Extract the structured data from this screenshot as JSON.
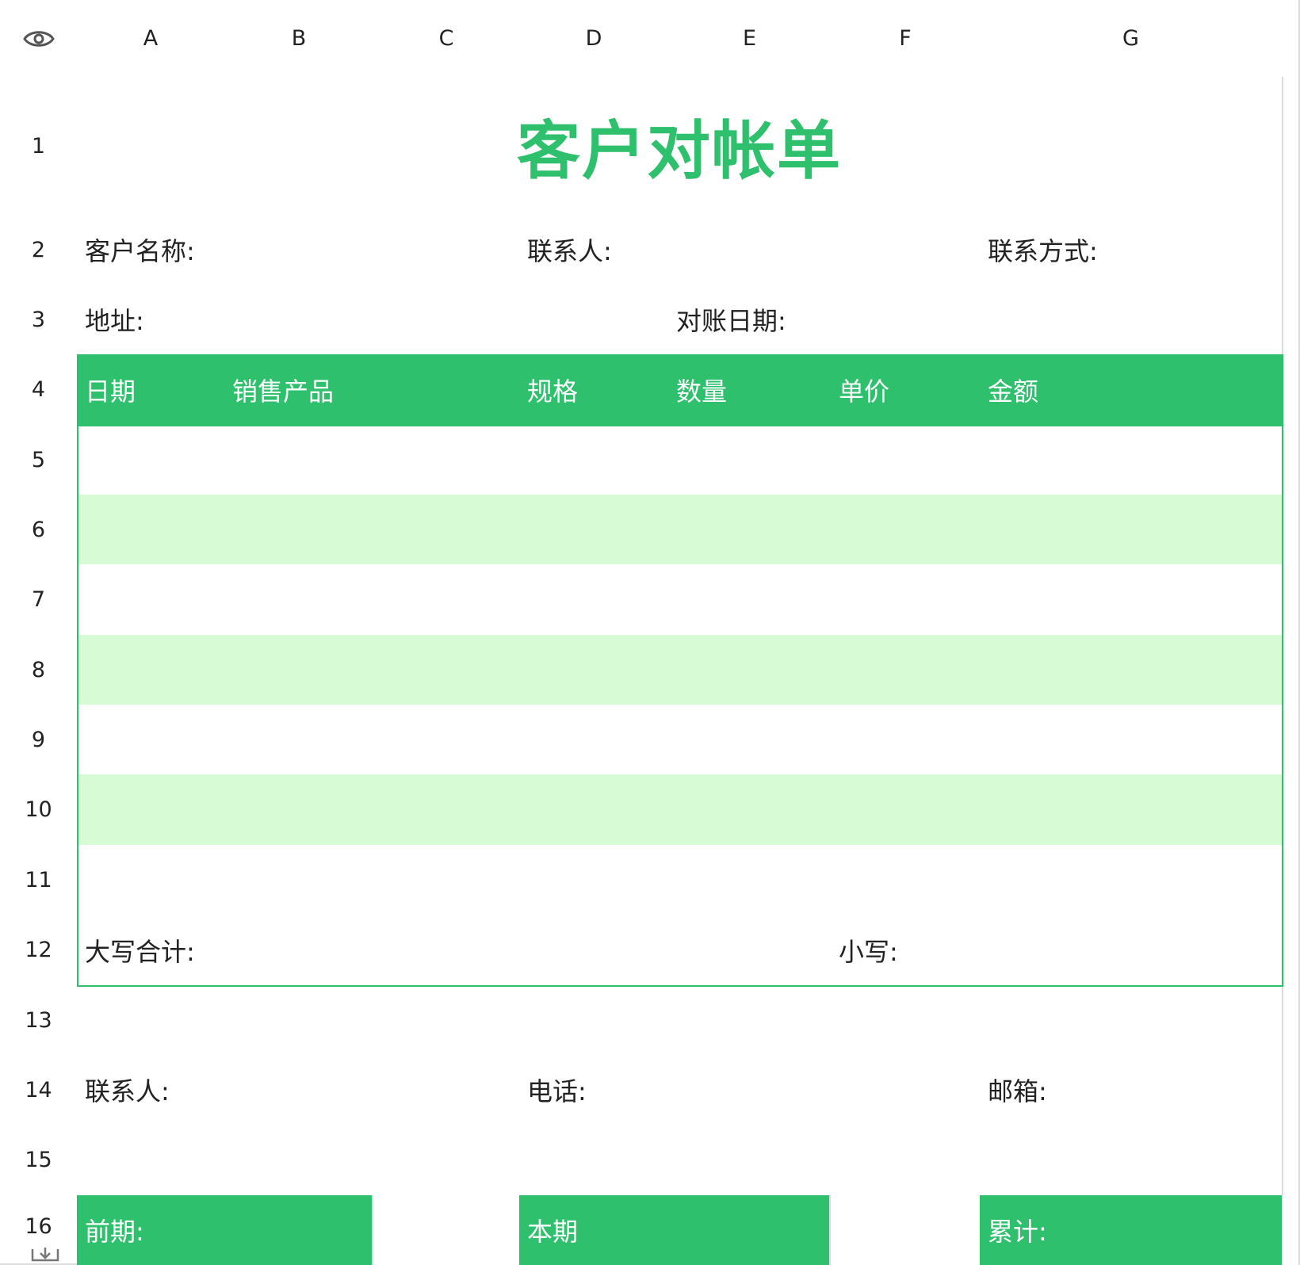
{
  "app": {
    "column_headers": [
      "A",
      "B",
      "C",
      "D",
      "E",
      "F",
      "G"
    ],
    "row_headers": [
      "1",
      "2",
      "3",
      "4",
      "5",
      "6",
      "7",
      "8",
      "9",
      "10",
      "11",
      "12",
      "13",
      "14",
      "15",
      "16"
    ],
    "toolbar_icon": "eye-icon",
    "footer_icon": "download-icon"
  },
  "sheet": {
    "title": "客户对帐单",
    "row2": {
      "customer_name": "客户名称:",
      "contact_person": "联系人:",
      "contact_method": "联系方式:"
    },
    "row3": {
      "address": "地址:",
      "statement_date": "对账日期:"
    },
    "table_header": [
      "日期",
      "销售产品",
      "规格",
      "数量",
      "单价",
      "金额"
    ],
    "row12": {
      "total_uppercase": "大写合计:",
      "total_lowercase": "小写:"
    },
    "row14": {
      "contact": "联系人:",
      "phone": "电话:",
      "email": "邮箱:"
    },
    "row16": {
      "previous": "前期:",
      "current": "本期",
      "cumulative": "累计:"
    }
  },
  "colors": {
    "accent": "#2ec06c",
    "stripe": "#d7fbd5",
    "grid": "#dcdcdc"
  }
}
